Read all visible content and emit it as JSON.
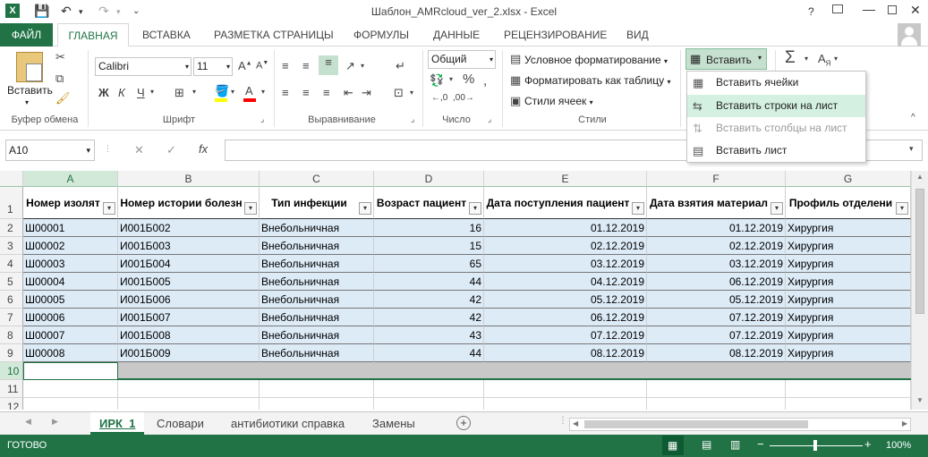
{
  "titlebar": {
    "title": "Шаблон_AMRcloud_ver_2.xlsx - Excel",
    "help": "?"
  },
  "ribbon_tabs": [
    "ФАЙЛ",
    "ГЛАВНАЯ",
    "ВСТАВКА",
    "РАЗМЕТКА СТРАНИЦЫ",
    "ФОРМУЛЫ",
    "ДАННЫЕ",
    "РЕЦЕНЗИРОВАНИЕ",
    "ВИД"
  ],
  "ribbon": {
    "paste_label": "Вставить",
    "font_name": "Calibri",
    "font_size": "11",
    "number_format": "Общий",
    "groups": {
      "clipboard": "Буфер обмена",
      "font": "Шрифт",
      "alignment": "Выравнивание",
      "number": "Число",
      "styles": "Стили"
    },
    "styles": {
      "conditional": "Условное форматирование",
      "format_table": "Форматировать как таблицу",
      "cell_styles": "Стили ячеек"
    },
    "cells_insert": "Вставить",
    "sum": "Σ"
  },
  "insert_menu": {
    "items": [
      {
        "label": "Вставить ячейки",
        "state": "normal"
      },
      {
        "label": "Вставить строки на лист",
        "state": "highlighted"
      },
      {
        "label": "Вставить столбцы на лист",
        "state": "disabled"
      },
      {
        "label": "Вставить лист",
        "state": "normal"
      }
    ]
  },
  "formula_bar": {
    "name_box": "A10",
    "fx": "fx",
    "value": ""
  },
  "grid": {
    "columns": [
      "A",
      "B",
      "C",
      "D",
      "E",
      "F",
      "G"
    ],
    "header_row": [
      "Номер изолят",
      "Номер истории болезн",
      "Тип инфекции",
      "Возраст пациент",
      "Дата поступления пациент",
      "Дата взятия материал",
      "Профиль отделени"
    ],
    "rows": [
      [
        "Ш00001",
        "И001Б002",
        "Внебольничная",
        "16",
        "01.12.2019",
        "01.12.2019",
        "Хирургия"
      ],
      [
        "Ш00002",
        "И001Б003",
        "Внебольничная",
        "15",
        "02.12.2019",
        "02.12.2019",
        "Хирургия"
      ],
      [
        "Ш00003",
        "И001Б004",
        "Внебольничная",
        "65",
        "03.12.2019",
        "03.12.2019",
        "Хирургия"
      ],
      [
        "Ш00004",
        "И001Б005",
        "Внебольничная",
        "44",
        "04.12.2019",
        "06.12.2019",
        "Хирургия"
      ],
      [
        "Ш00005",
        "И001Б006",
        "Внебольничная",
        "42",
        "05.12.2019",
        "05.12.2019",
        "Хирургия"
      ],
      [
        "Ш00006",
        "И001Б007",
        "Внебольничная",
        "42",
        "06.12.2019",
        "07.12.2019",
        "Хирургия"
      ],
      [
        "Ш00007",
        "И001Б008",
        "Внебольничная",
        "43",
        "07.12.2019",
        "07.12.2019",
        "Хирургия"
      ],
      [
        "Ш00008",
        "И001Б009",
        "Внебольничная",
        "44",
        "08.12.2019",
        "08.12.2019",
        "Хирургия"
      ]
    ],
    "row_numbers": [
      "1",
      "2",
      "3",
      "4",
      "5",
      "6",
      "7",
      "8",
      "9",
      "10",
      "11",
      "12"
    ],
    "selected_row": "10"
  },
  "sheets": [
    "ИРК_1",
    "Словари",
    "антибиотики справка",
    "Замены"
  ],
  "active_sheet": "ИРК_1",
  "status": {
    "ready": "ГОТОВО",
    "zoom": "100%"
  },
  "colors": {
    "accent": "#217346",
    "table_band": "#ddebf7",
    "highlight": "#d3f0e0"
  }
}
